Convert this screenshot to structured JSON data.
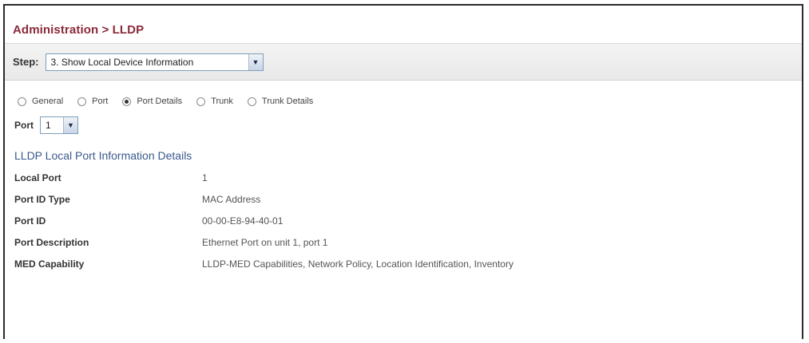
{
  "title": "Administration > LLDP",
  "step": {
    "label": "Step:",
    "selected": "3. Show Local Device Information"
  },
  "view_options": [
    {
      "label": "General",
      "checked": false
    },
    {
      "label": "Port",
      "checked": false
    },
    {
      "label": "Port Details",
      "checked": true
    },
    {
      "label": "Trunk",
      "checked": false
    },
    {
      "label": "Trunk Details",
      "checked": false
    }
  ],
  "port": {
    "label": "Port",
    "selected": "1"
  },
  "section_title": "LLDP Local Port Information Details",
  "details": [
    {
      "key": "Local Port",
      "value": "1"
    },
    {
      "key": "Port ID Type",
      "value": "MAC Address"
    },
    {
      "key": "Port ID",
      "value": "00-00-E8-94-40-01"
    },
    {
      "key": "Port Description",
      "value": "Ethernet Port on unit 1, port 1"
    },
    {
      "key": "MED Capability",
      "value": "LLDP-MED Capabilities, Network Policy, Location Identification, Inventory"
    }
  ]
}
